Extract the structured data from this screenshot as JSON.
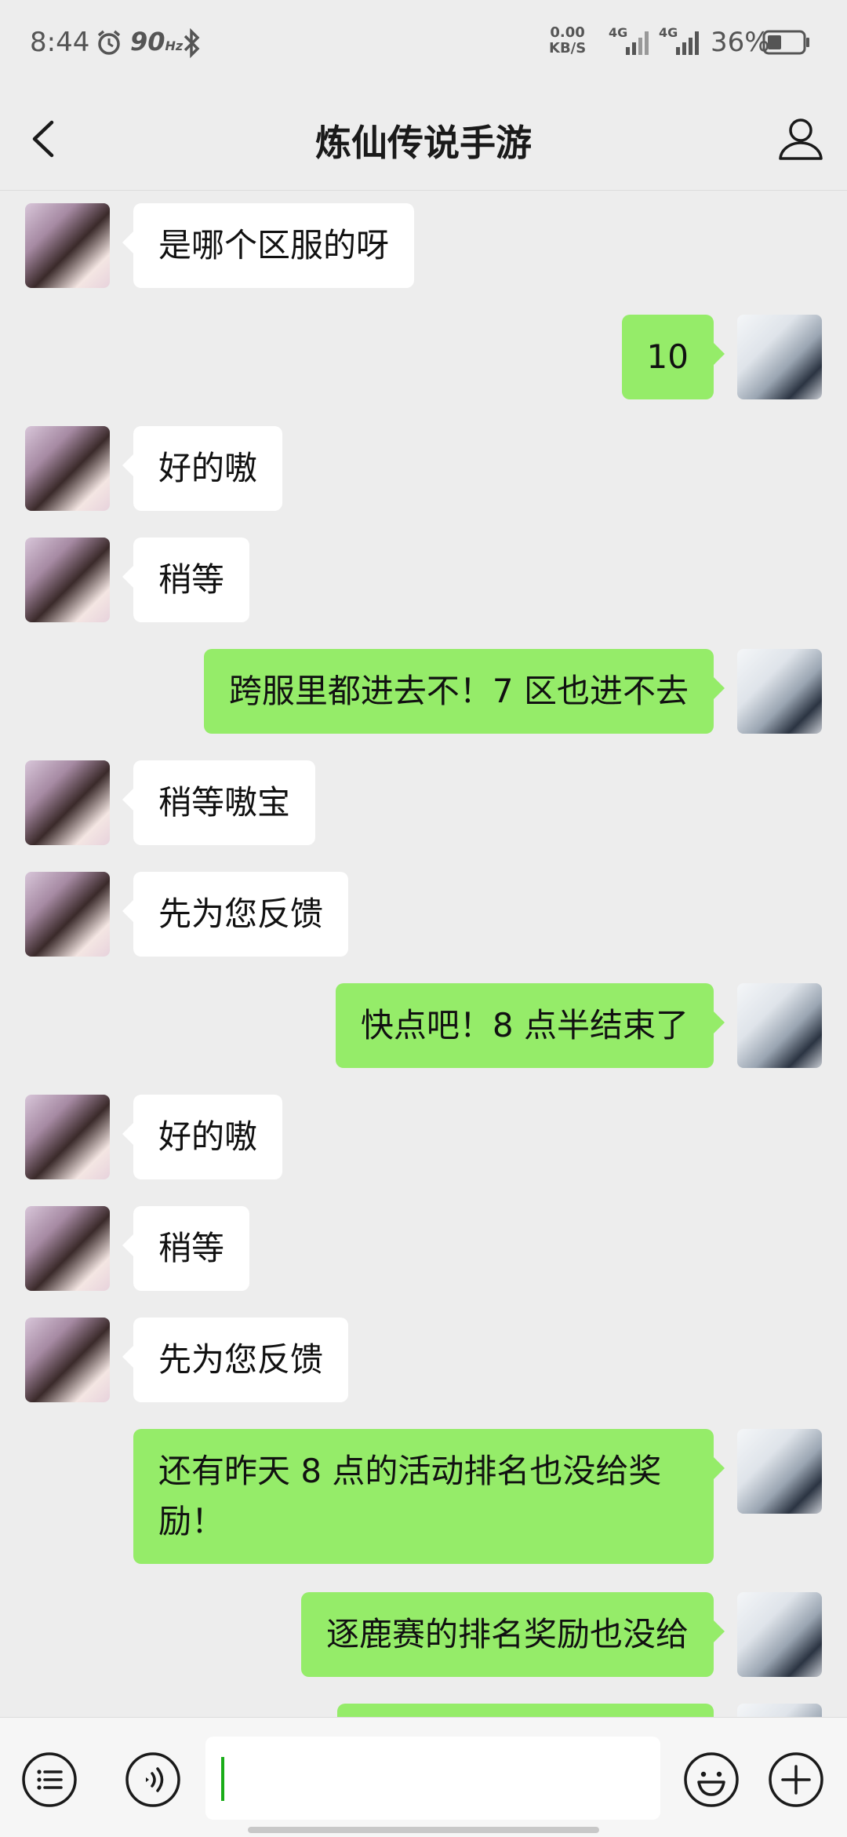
{
  "status_bar": {
    "time": "8:44",
    "refresh_rate": "90",
    "refresh_unit": "Hz",
    "net_speed_value": "0.00",
    "net_speed_unit": "KB/S",
    "sim1": "4G",
    "sim2": "4G",
    "battery": "36%"
  },
  "header": {
    "title": "炼仙传说手游"
  },
  "messages": [
    {
      "side": "left",
      "text": "是哪个区服的呀"
    },
    {
      "side": "right",
      "text": "10"
    },
    {
      "side": "left",
      "text": "好的嗷"
    },
    {
      "side": "left",
      "text": "稍等"
    },
    {
      "side": "right",
      "text": "跨服里都进去不！7 区也进不去"
    },
    {
      "side": "left",
      "text": "稍等嗷宝"
    },
    {
      "side": "left",
      "text": "先为您反馈"
    },
    {
      "side": "right",
      "text": "快点吧！8 点半结束了"
    },
    {
      "side": "left",
      "text": "好的嗷"
    },
    {
      "side": "left",
      "text": "稍等"
    },
    {
      "side": "left",
      "text": "先为您反馈"
    },
    {
      "side": "right",
      "text": "还有昨天 8 点的活动排名也没给奖励！"
    },
    {
      "side": "right",
      "text": "逐鹿赛的排名奖励也没给"
    },
    {
      "side": "right",
      "text": ""
    }
  ],
  "input": {
    "value": ""
  },
  "colors": {
    "background": "#ededed",
    "bubble_sent": "#95ec69",
    "bubble_received": "#ffffff",
    "caret": "#1aad19"
  }
}
